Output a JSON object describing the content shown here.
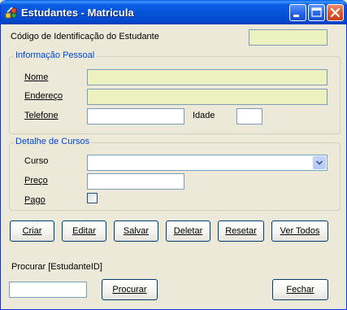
{
  "window": {
    "title": "Estudantes - Matricula",
    "buttons": [
      "minimize",
      "maximize",
      "close"
    ]
  },
  "student_id": {
    "label": "Código de Identificação do Estudante",
    "value": ""
  },
  "personal_info": {
    "title": "Informação Pessoal",
    "nome_label": "Nome",
    "nome_value": "",
    "endereco_label": "Endereço",
    "endereco_value": "",
    "telefone_label": "Telefone",
    "telefone_value": "",
    "idade_label": "Idade",
    "idade_value": ""
  },
  "course_details": {
    "title": "Detalhe de Cursos",
    "curso_label": "Curso",
    "curso_value": "",
    "preco_label": "Preço",
    "preco_value": "",
    "pago_label": "Pago",
    "pago_checked": false
  },
  "actions": {
    "criar": "Criar",
    "editar": "Editar",
    "salvar": "Salvar",
    "deletar": "Deletar",
    "resetar": "Resetar",
    "ver_todos": "Ver Todos"
  },
  "search": {
    "label": "Procurar  [EstudanteID]",
    "value": "",
    "button": "Procurar"
  },
  "close_button": "Fechar",
  "icons": {
    "app": "student-app-icon",
    "minimize": "minimize-icon",
    "maximize": "maximize-icon",
    "close": "close-icon",
    "dropdown": "chevron-down-icon"
  },
  "colors": {
    "titlebar": "#0553d8",
    "readonly_field": "#ebf1bf",
    "group_title": "#0046d5",
    "window_bg": "#ece9d8"
  }
}
